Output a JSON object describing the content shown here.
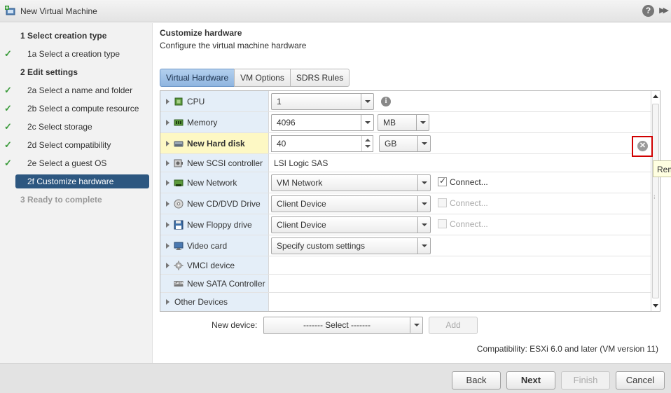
{
  "window": {
    "title": "New Virtual Machine",
    "help_glyph": "?",
    "expand_glyph": "▶▶"
  },
  "steps": [
    {
      "label": "1  Select creation type",
      "kind": "head"
    },
    {
      "label": "1a  Select a creation type",
      "kind": "done"
    },
    {
      "label": "2  Edit settings",
      "kind": "head"
    },
    {
      "label": "2a  Select a name and folder",
      "kind": "done"
    },
    {
      "label": "2b  Select a compute resource",
      "kind": "done"
    },
    {
      "label": "2c  Select storage",
      "kind": "done"
    },
    {
      "label": "2d  Select compatibility",
      "kind": "done"
    },
    {
      "label": "2e  Select a guest OS",
      "kind": "done"
    },
    {
      "label": "2f  Customize hardware",
      "kind": "active"
    },
    {
      "label": "3  Ready to complete",
      "kind": "disabled"
    }
  ],
  "check_glyph": "✓",
  "content": {
    "title": "Customize hardware",
    "subtitle": "Configure the virtual machine hardware"
  },
  "tabs": [
    "Virtual Hardware",
    "VM Options",
    "SDRS Rules"
  ],
  "hardware": {
    "cpu": {
      "label": "CPU",
      "value": "1",
      "info_glyph": "i"
    },
    "memory": {
      "label": "Memory",
      "value": "4096",
      "unit": "MB"
    },
    "hard_disk": {
      "label": "New Hard disk",
      "value": "40",
      "unit": "GB"
    },
    "scsi": {
      "label": "New SCSI controller",
      "value": "LSI Logic SAS"
    },
    "network": {
      "label": "New Network",
      "value": "VM Network",
      "connect_label": "Connect...",
      "connected": true
    },
    "cddvd": {
      "label": "New CD/DVD Drive",
      "value": "Client Device",
      "connect_label": "Connect...",
      "connected": false
    },
    "floppy": {
      "label": "New Floppy drive",
      "value": "Client Device",
      "connect_label": "Connect...",
      "connected": false
    },
    "video": {
      "label": "Video card",
      "value": "Specify custom settings"
    },
    "vmci": {
      "label": "VMCI device"
    },
    "sata": {
      "label": "New SATA Controller",
      "icon_text": "SATA"
    },
    "other": {
      "label": "Other Devices"
    }
  },
  "remove": {
    "glyph": "✕",
    "tooltip": "Remove"
  },
  "new_device": {
    "label": "New device:",
    "select_value": "------- Select -------",
    "add_label": "Add"
  },
  "compatibility": "Compatibility: ESXi 6.0 and later (VM version 11)",
  "footer": {
    "back": "Back",
    "next": "Next",
    "finish": "Finish",
    "cancel": "Cancel"
  },
  "colors": {
    "active_step": "#2d5780",
    "check": "#3a9b3a",
    "highlight_row": "#fdf8c4",
    "label_column": "#e4eef8",
    "remove_outline": "#d00000"
  }
}
